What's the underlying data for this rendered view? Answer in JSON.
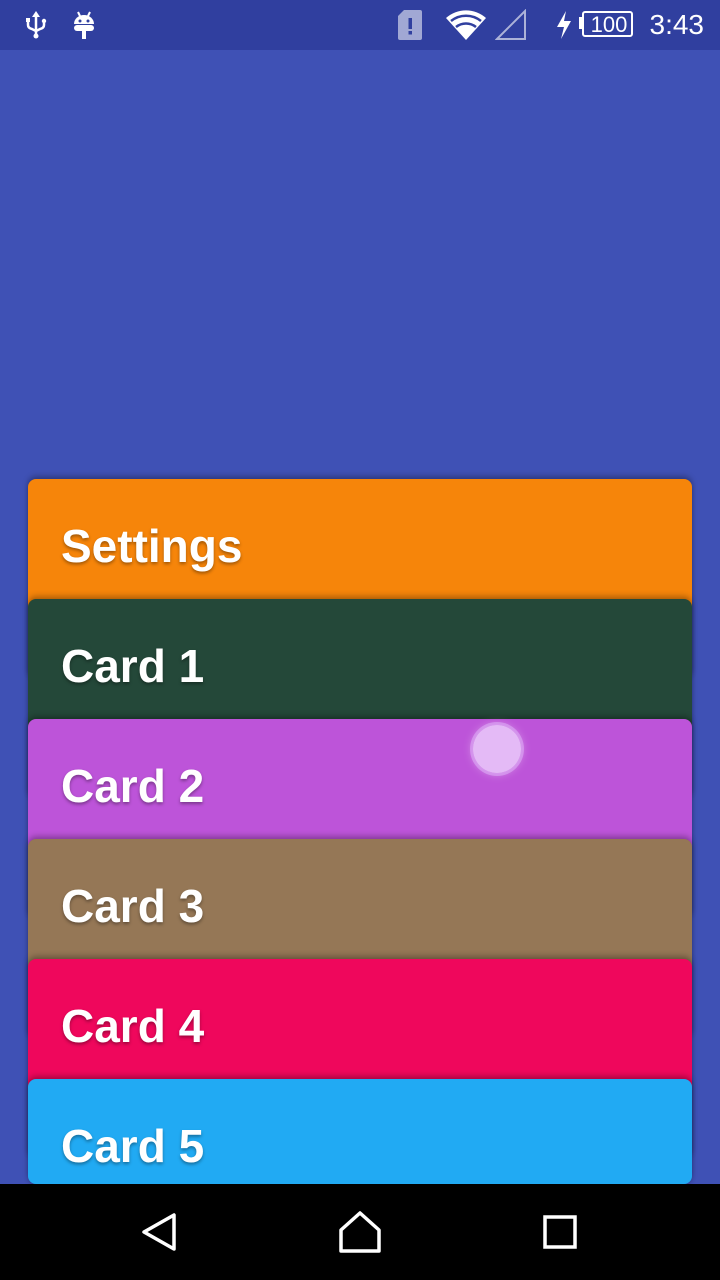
{
  "status_bar": {
    "icons": [
      "usb-icon",
      "android-debug-icon",
      "sim-alert-icon",
      "wifi-icon",
      "cell-signal-icon",
      "charging-icon",
      "battery-icon"
    ],
    "battery_level": "100",
    "time": "3:43"
  },
  "colors": {
    "background": "#3f51b5",
    "status_bar": "#303f9f",
    "settings_card": "#f6850a",
    "card1": "#244839",
    "card2": "#bd54d9",
    "card3": "#957756",
    "card4": "#ef075c",
    "card5": "#21aaf3"
  },
  "cards": [
    {
      "title": "Settings"
    },
    {
      "title": "Card 1"
    },
    {
      "title": "Card 2"
    },
    {
      "title": "Card 3"
    },
    {
      "title": "Card 4"
    },
    {
      "title": "Card 5"
    }
  ],
  "nav_bar": {
    "icons": [
      "back-icon",
      "home-icon",
      "recents-icon"
    ]
  }
}
